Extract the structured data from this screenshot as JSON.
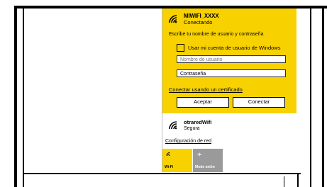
{
  "selected_network": {
    "name": "MIWIFI_XXXX",
    "status": "Conectando",
    "prompt": "Escribe tu nombre de usuario y contraseña",
    "windows_account_label": "Usar mi cuenta de usuario de Windows",
    "username_placeholder": "Nombre de usuario",
    "password_value": "Contraseña",
    "cert_link": "Conectar usando un certificado",
    "accept_label": "Aceptar",
    "connect_label": "Conectar"
  },
  "other_network": {
    "name": "otraredWifi",
    "status": "Segura"
  },
  "network_settings_link": "Configuración de red",
  "quick_actions": [
    {
      "label": "Wi-Fi",
      "icon": "wifi-icon",
      "active": true
    },
    {
      "label": "Modo avión",
      "icon": "airplane-icon",
      "active": false
    }
  ],
  "colors": {
    "accent": "#f8d200",
    "inactive_tile": "#9a9a9a"
  }
}
